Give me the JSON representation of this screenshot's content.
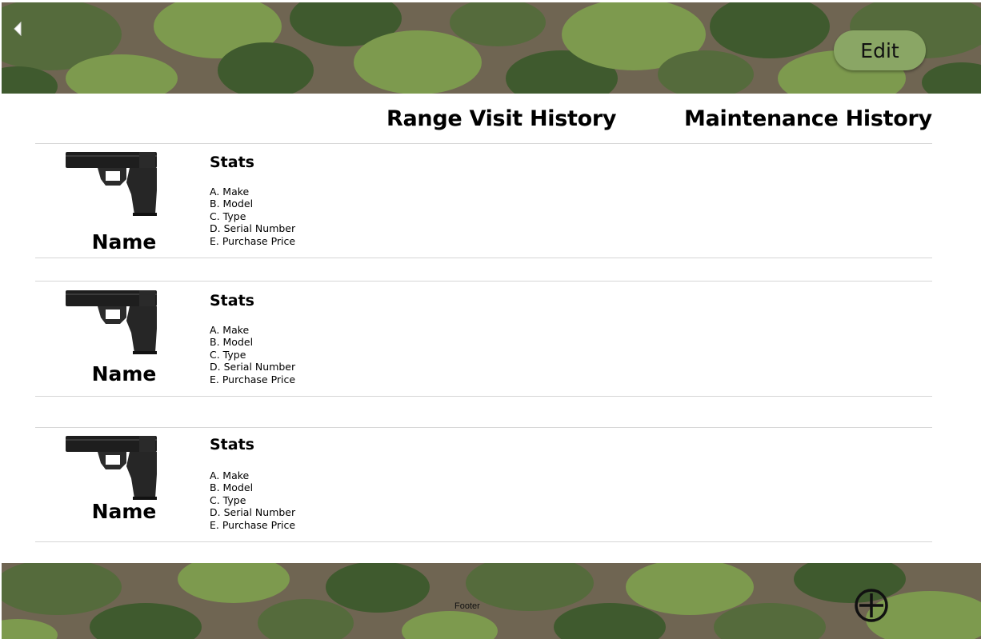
{
  "header": {
    "back_icon": "chevron-left-icon",
    "edit_label": "Edit",
    "accent_color": "#8aa665"
  },
  "columns": {
    "range_visit_history": "Range Visit History",
    "maintenance_history": "Maintenance History"
  },
  "firearms": [
    {
      "name": "Name",
      "stats_title": "Stats",
      "stats": [
        "A. Make",
        "B. Model",
        "C. Type",
        "D. Serial Number",
        "E. Purchase Price"
      ]
    },
    {
      "name": "Name",
      "stats_title": "Stats",
      "stats": [
        "A. Make",
        "B. Model",
        "C. Type",
        "D. Serial Number",
        "E. Purchase Price"
      ]
    },
    {
      "name": "Name",
      "stats_title": "Stats",
      "stats": [
        "A. Make",
        "B. Model",
        "C. Type",
        "D. Serial Number",
        "E. Purchase Price"
      ]
    }
  ],
  "footer": {
    "text": "Footer",
    "add_icon": "plus-circle-icon"
  },
  "theme": {
    "camo_colors": [
      "#6f6552",
      "#556b3c",
      "#7d9a4e",
      "#3f5a2e"
    ]
  }
}
